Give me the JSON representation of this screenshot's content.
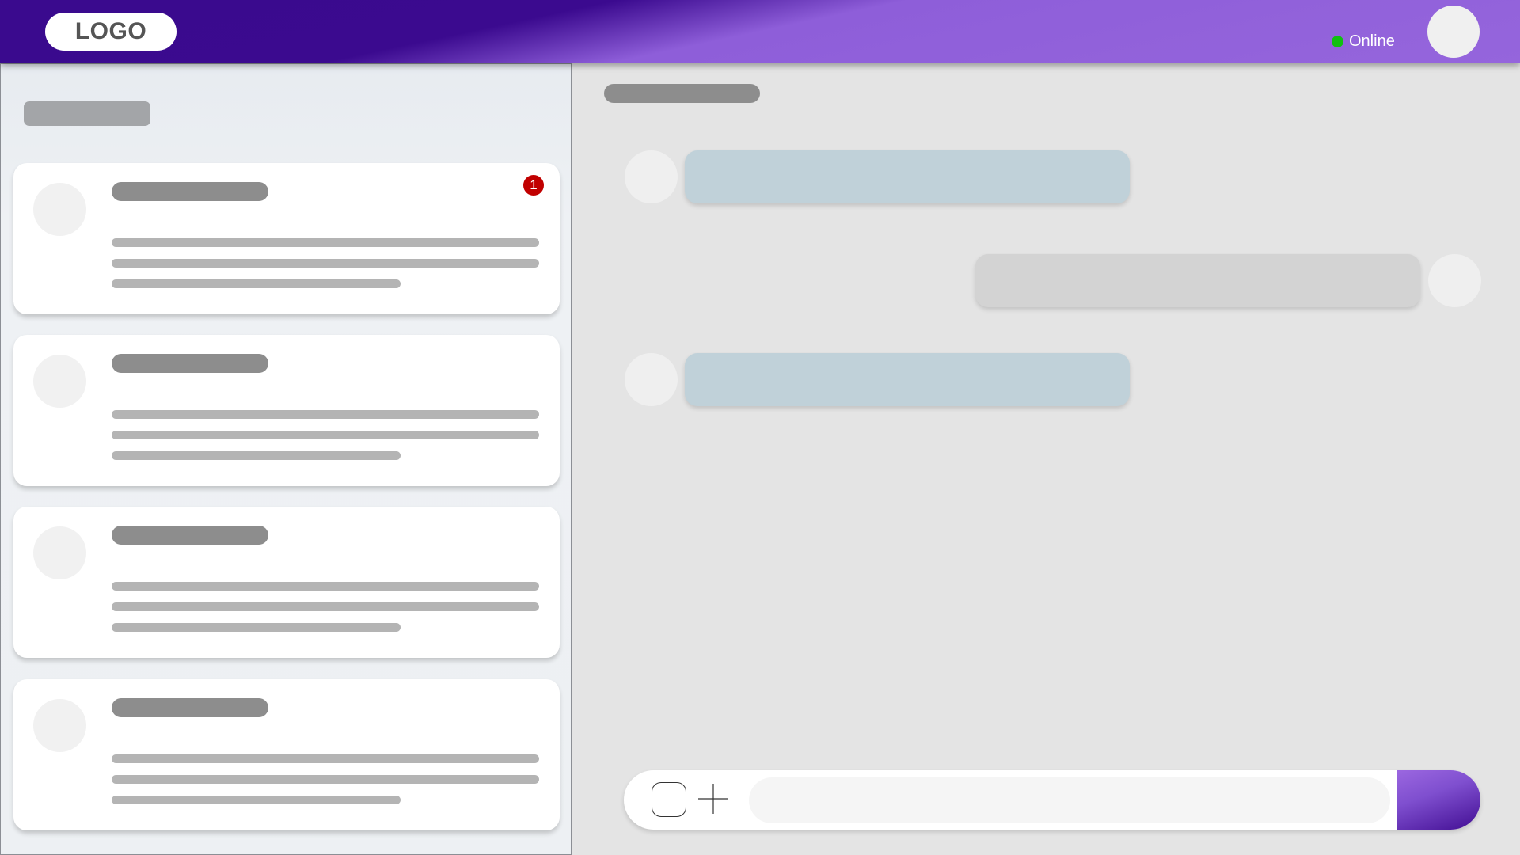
{
  "header": {
    "logo_text": "LOGO",
    "status_text": "Online",
    "status_color": "#10c010",
    "gradient_colors": [
      "#3a0a8e",
      "#9565dc"
    ]
  },
  "sidebar": {
    "conversations": [
      {
        "unread_count": "1"
      },
      {
        "unread_count": null
      },
      {
        "unread_count": null
      },
      {
        "unread_count": null
      }
    ]
  },
  "chat": {
    "messages": [
      {
        "direction": "incoming",
        "bubble_color": "#c0d1d9"
      },
      {
        "direction": "outgoing",
        "bubble_color": "#d3d3d3"
      },
      {
        "direction": "incoming",
        "bubble_color": "#c0d1d9"
      }
    ],
    "composer": {
      "input_value": "",
      "placeholder": ""
    }
  },
  "icons": {
    "emoji": "emoji-icon",
    "attach": "plus-icon",
    "send": "send-icon"
  }
}
